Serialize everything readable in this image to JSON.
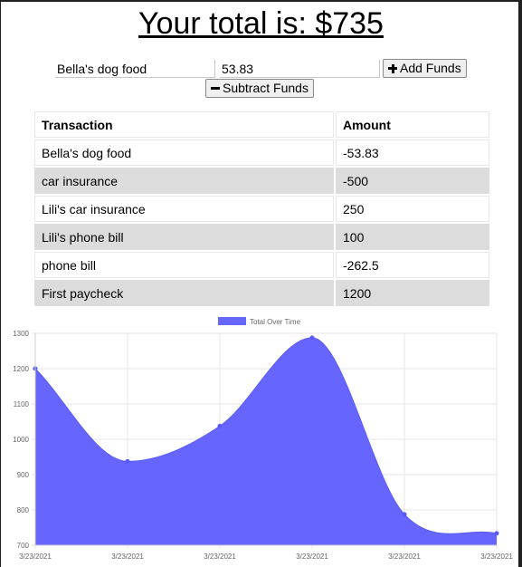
{
  "header": {
    "total_text": "Your total is: $735"
  },
  "form": {
    "name_value": "Bella's dog food",
    "amount_value": "53.83",
    "add_label": "Add Funds",
    "subtract_label": "Subtract Funds"
  },
  "table": {
    "headers": [
      "Transaction",
      "Amount"
    ],
    "rows": [
      {
        "name": "Bella's dog food",
        "amount": "-53.83"
      },
      {
        "name": "car insurance",
        "amount": "-500"
      },
      {
        "name": "Lili's car insurance",
        "amount": "250"
      },
      {
        "name": "Lili's phone bill",
        "amount": "100"
      },
      {
        "name": "phone bill",
        "amount": "-262.5"
      },
      {
        "name": "First paycheck",
        "amount": "1200"
      }
    ]
  },
  "chart_data": {
    "type": "area",
    "legend": "Total Over Time",
    "legend_position": "top",
    "x": [
      "3/23/2021",
      "3/23/2021",
      "3/23/2021",
      "3/23/2021",
      "3/23/2021",
      "3/23/2021"
    ],
    "series": [
      {
        "name": "Total Over Time",
        "values": [
          1200,
          937.5,
          1037.5,
          1287.5,
          787.5,
          733.67
        ]
      }
    ],
    "ylim": [
      700,
      1300
    ],
    "yticks": [
      700,
      800,
      900,
      1000,
      1100,
      1200,
      1300
    ],
    "grid": true,
    "color": "#6666ff"
  }
}
